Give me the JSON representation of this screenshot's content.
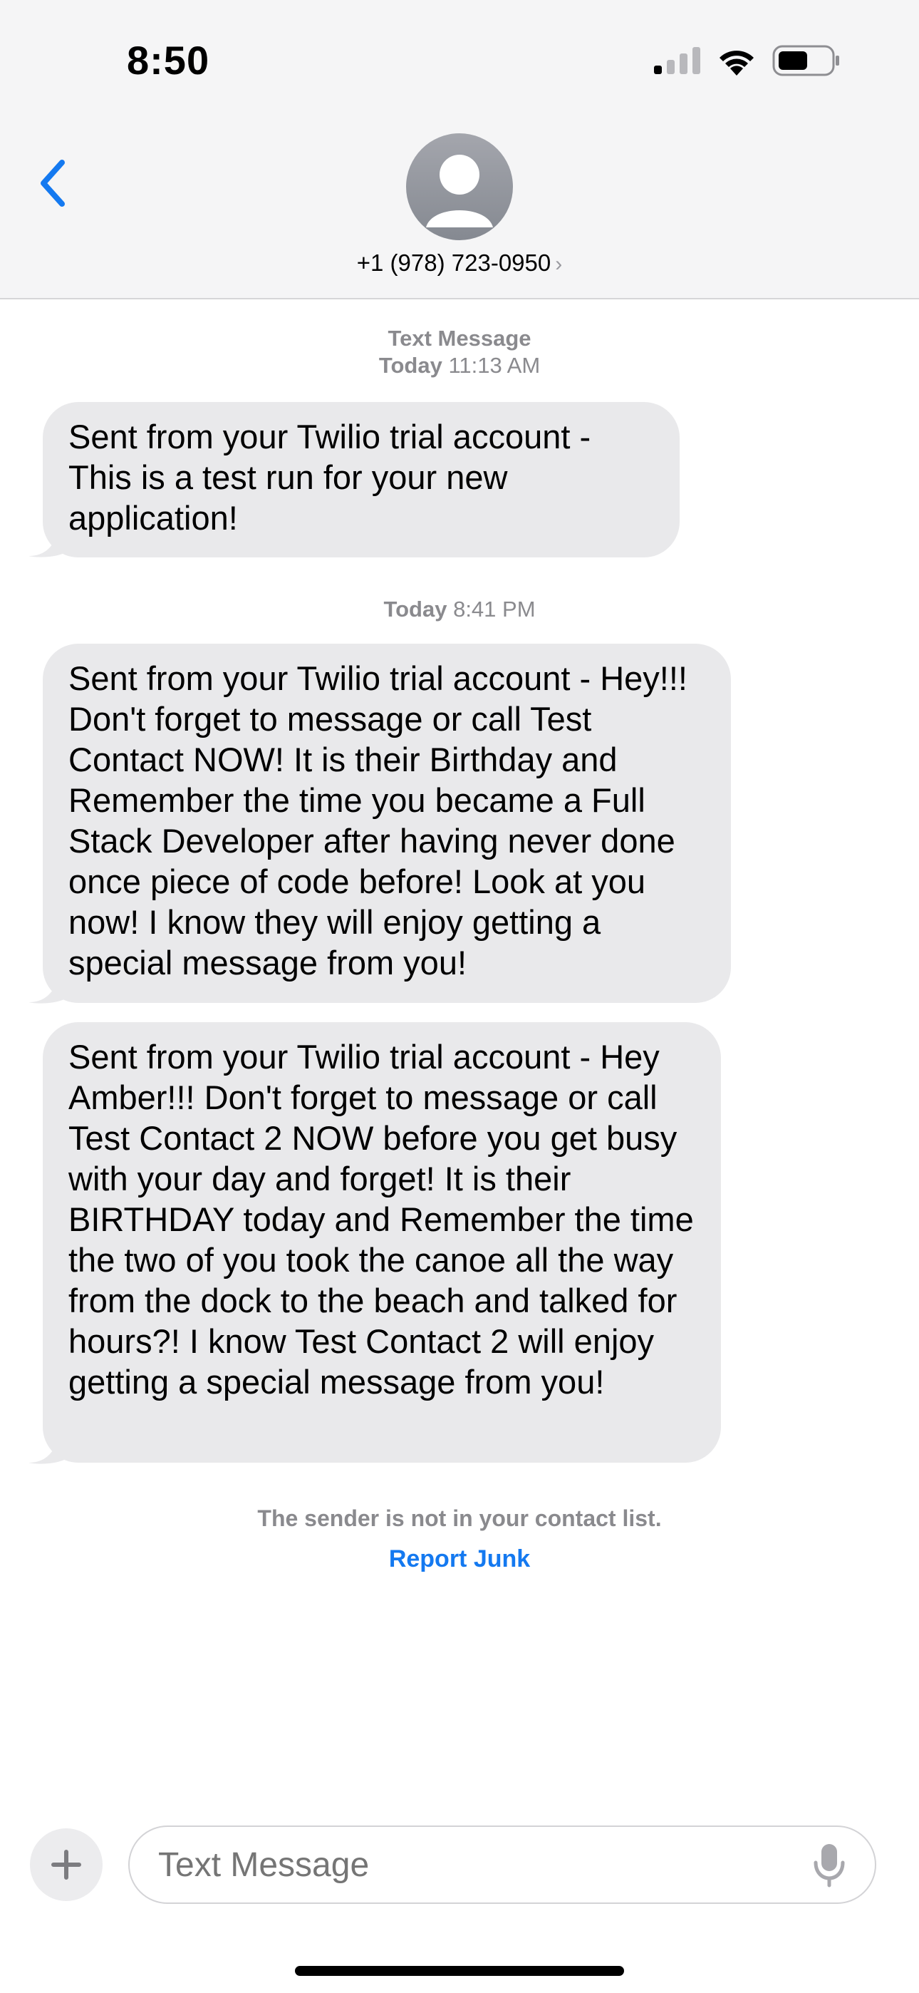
{
  "status_bar": {
    "time": "8:50",
    "signal_icon": "cellular-signal-icon",
    "wifi_icon": "wifi-icon",
    "battery_icon": "battery-icon"
  },
  "header": {
    "back_icon": "chevron-left-icon",
    "avatar_icon": "person-avatar-icon",
    "contact_name": "+1 (978) 723-0950",
    "contact_chevron": "›"
  },
  "conversation": {
    "timestamp1": {
      "label": "Text Message",
      "day": "Today",
      "time": "11:13 AM"
    },
    "message1": "Sent from your Twilio trial account - This is a test run for your new application!",
    "timestamp2": {
      "day": "Today",
      "time": "8:41 PM"
    },
    "message2": "Sent from your Twilio trial account - Hey!!! Don't forget to message or call Test Contact NOW! It is their Birthday and Remember the time you became a Full Stack Developer after having never done once piece of code before! Look at you now! I know they will enjoy getting a special message from you!",
    "message3": "Sent from your Twilio trial account - Hey Amber!!! Don't forget to message or call Test Contact 2 NOW before you get busy with your day and forget! It is their BIRTHDAY today and Remember the time the two of you took the canoe all the way from the dock to the beach and talked for hours?! I know Test Contact 2 will enjoy getting a special message from you!",
    "notice": "The sender is not in your contact list.",
    "report_junk": "Report Junk"
  },
  "composer": {
    "plus_icon": "plus-icon",
    "placeholder": "Text Message",
    "mic_icon": "microphone-icon"
  },
  "colors": {
    "accent": "#1479f0",
    "bubble": "#e9e9eb",
    "header_bg": "#f5f5f6",
    "meta_text": "#8a8a8e"
  }
}
